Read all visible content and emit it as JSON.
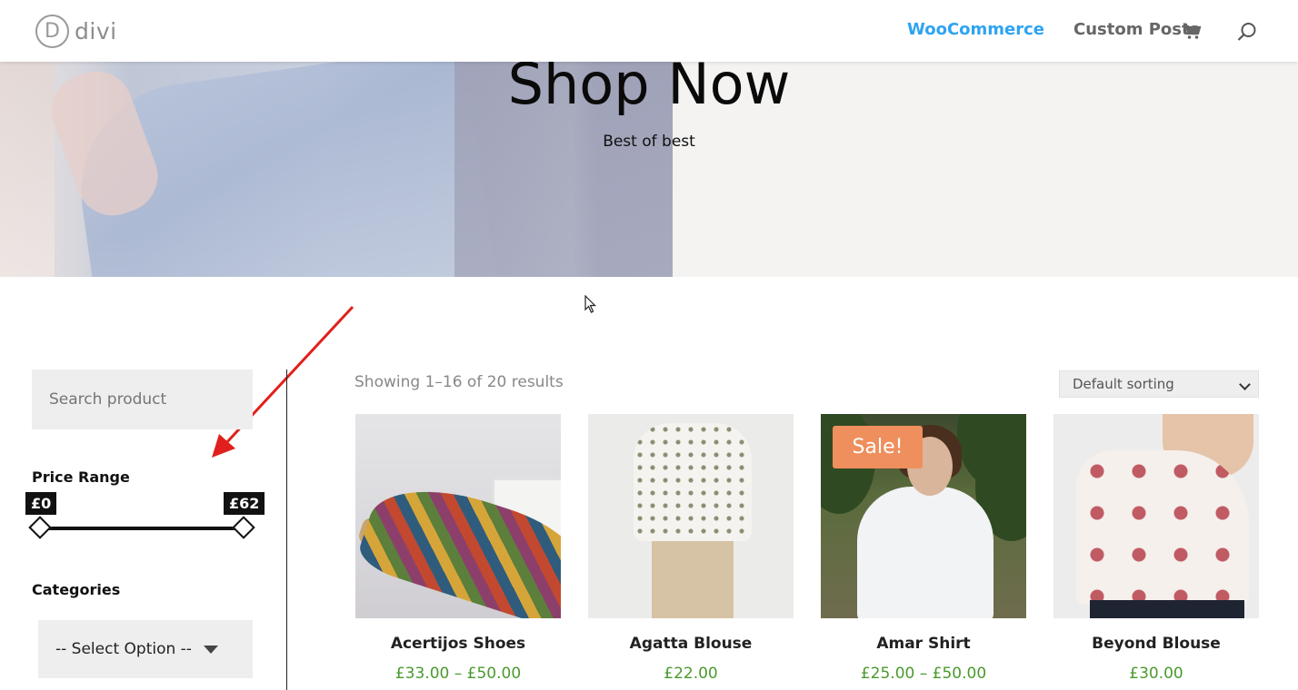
{
  "header": {
    "logo_letter": "D",
    "logo_text": "divi",
    "nav": [
      {
        "label": "WooCommerce",
        "active": true
      },
      {
        "label": "Custom Posts",
        "active": false
      }
    ],
    "icons": [
      "cart-icon",
      "search-icon"
    ],
    "accent_color": "#2ea3f2"
  },
  "hero": {
    "title": "Shop Now",
    "subtitle": "Best of best"
  },
  "sidebar": {
    "search_placeholder": "Search product",
    "price_range": {
      "title": "Price Range",
      "min_label": "£0",
      "max_label": "£62",
      "min_value": 0,
      "max_value": 62
    },
    "categories": {
      "title": "Categories",
      "selected": "-- Select Option --"
    }
  },
  "main": {
    "result_count": "Showing 1–16 of 20 results",
    "sort": "Default sorting",
    "products": [
      {
        "name": "Acertijos Shoes",
        "price": "£33.00 – £50.00",
        "sale": false
      },
      {
        "name": "Agatta Blouse",
        "price": "£22.00",
        "sale": false
      },
      {
        "name": "Amar Shirt",
        "price": "£25.00 – £50.00",
        "sale": true,
        "badge": "Sale!"
      },
      {
        "name": "Beyond Blouse",
        "price": "£30.00",
        "sale": false
      }
    ],
    "price_color": "#4a9a2e",
    "sale_color": "#ef8f5d"
  }
}
